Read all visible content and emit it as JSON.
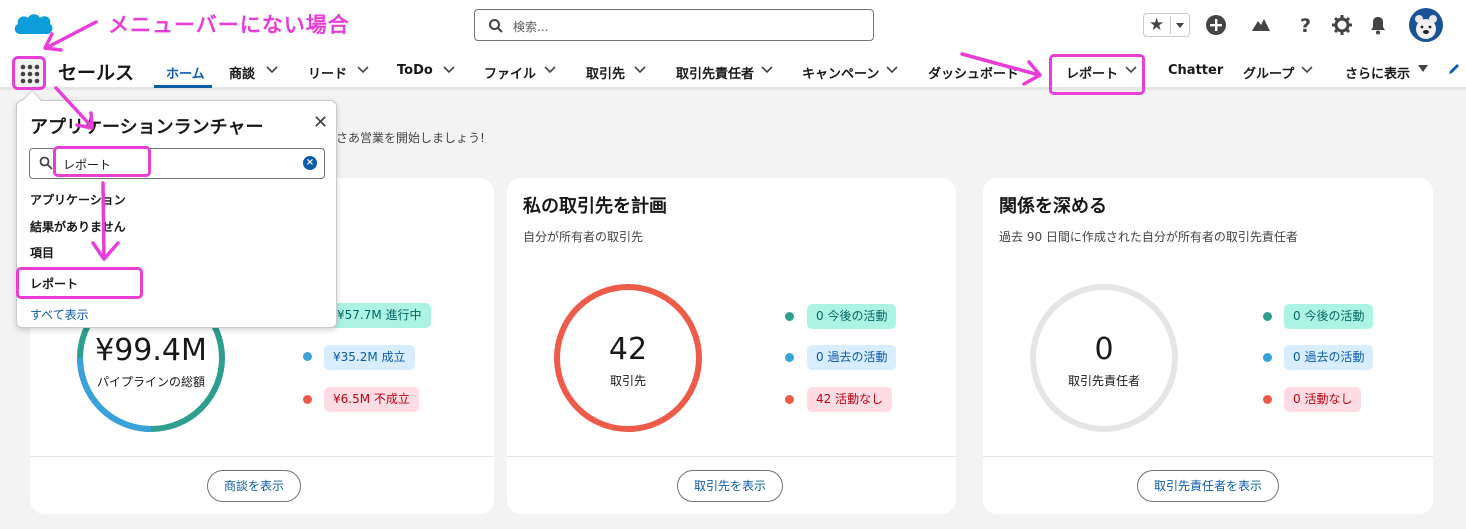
{
  "annotation": {
    "title": "メニューバーにない場合"
  },
  "header": {
    "search_placeholder": "検索..."
  },
  "nav": {
    "app_name": "セールス",
    "items": [
      {
        "label": "ホーム",
        "active": true
      },
      {
        "label": "商談"
      },
      {
        "label": "リード"
      },
      {
        "label": "ToDo"
      },
      {
        "label": "ファイル"
      },
      {
        "label": "取引先"
      },
      {
        "label": "取引先責任者"
      },
      {
        "label": "キャンペーン"
      },
      {
        "label": "ダッシュボード"
      },
      {
        "label": "レポート"
      },
      {
        "label": "Chatter"
      },
      {
        "label": "グループ"
      },
      {
        "label": "さらに表示"
      }
    ]
  },
  "greeting": "さあ営業を開始しましょう!",
  "launcher": {
    "title": "アプリケーションランチャー",
    "search_value": "レポート",
    "apps_header": "アプリケーション",
    "no_results": "結果がありません",
    "items_header": "項目",
    "result_item": "レポート",
    "show_all": "すべて表示"
  },
  "cards": [
    {
      "title": "",
      "subtitle": "",
      "center_value": "¥99.4M",
      "center_label": "パイプラインの総額",
      "legend": [
        {
          "text": "¥57.7M 進行中",
          "status": "green"
        },
        {
          "text": "¥35.2M 成立",
          "status": "blue"
        },
        {
          "text": "¥6.5M 不成立",
          "status": "red"
        }
      ],
      "button": "商談を表示"
    },
    {
      "title": "私の取引先を計画",
      "subtitle": "自分が所有者の取引先",
      "center_value": "42",
      "center_label": "取引先",
      "legend": [
        {
          "text": "0 今後の活動",
          "status": "green"
        },
        {
          "text": "0 過去の活動",
          "status": "blue"
        },
        {
          "text": "42 活動なし",
          "status": "red"
        }
      ],
      "button": "取引先を表示"
    },
    {
      "title": "関係を深める",
      "subtitle": "過去 90 日間に作成された自分が所有者の取引先責任者",
      "center_value": "0",
      "center_label": "取引先責任者",
      "legend": [
        {
          "text": "0 今後の活動",
          "status": "green"
        },
        {
          "text": "0 過去の活動",
          "status": "blue"
        },
        {
          "text": "0 活動なし",
          "status": "red"
        }
      ],
      "button": "取引先責任者を表示"
    }
  ],
  "colors": {
    "brand_blue": "#0b5cab",
    "highlight_magenta": "#e83dd6",
    "ring_red": "#ef5b4b",
    "ring_teal": "#2e9e8f",
    "ring_blue": "#3aa1d9",
    "ring_gray": "#e5e5e5"
  },
  "icons": [
    "salesforce-cloud-logo",
    "search-icon",
    "star-icon",
    "add-icon",
    "trailhead-icon",
    "help-icon",
    "setup-gear-icon",
    "bell-icon",
    "app-launcher-waffle-icon",
    "chevron-down-icon",
    "edit-pencil-icon",
    "close-icon",
    "clear-icon"
  ]
}
